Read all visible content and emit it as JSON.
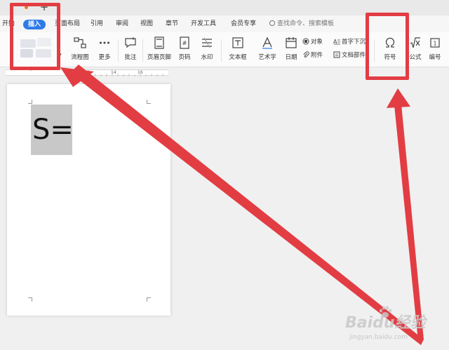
{
  "titlebar": {
    "new_tab_label": "+"
  },
  "tabs": [
    {
      "label": "开始",
      "active": false
    },
    {
      "label": "插入",
      "active": true
    },
    {
      "label": "页面布局",
      "active": false
    },
    {
      "label": "引用",
      "active": false
    },
    {
      "label": "审阅",
      "active": false
    },
    {
      "label": "视图",
      "active": false
    },
    {
      "label": "章节",
      "active": false
    },
    {
      "label": "开发工具",
      "active": false
    },
    {
      "label": "会员专享",
      "active": false
    }
  ],
  "search": {
    "placeholder": "查找命令、搜索模板"
  },
  "toolbar": {
    "flowchart": "流程图",
    "more": "更多",
    "comment": "批注",
    "header_footer": "页眉页脚",
    "page_number": "页码",
    "watermark": "水印",
    "textbox": "文本框",
    "wordart": "艺术字",
    "date": "日期",
    "object": "对象",
    "attachment": "附件",
    "drop_cap": "首字下沉",
    "doc_parts": "文档部件",
    "symbol": "符号",
    "formula": "公式",
    "numbering": "编号"
  },
  "ruler": {
    "marks": [
      "12",
      "14",
      "16"
    ]
  },
  "document": {
    "formula_text": "S="
  },
  "watermark": {
    "brand": "Baidu经验",
    "url": "jingyan.baidu.com"
  },
  "colors": {
    "accent": "#2e7be8",
    "highlight": "#e23d43"
  }
}
